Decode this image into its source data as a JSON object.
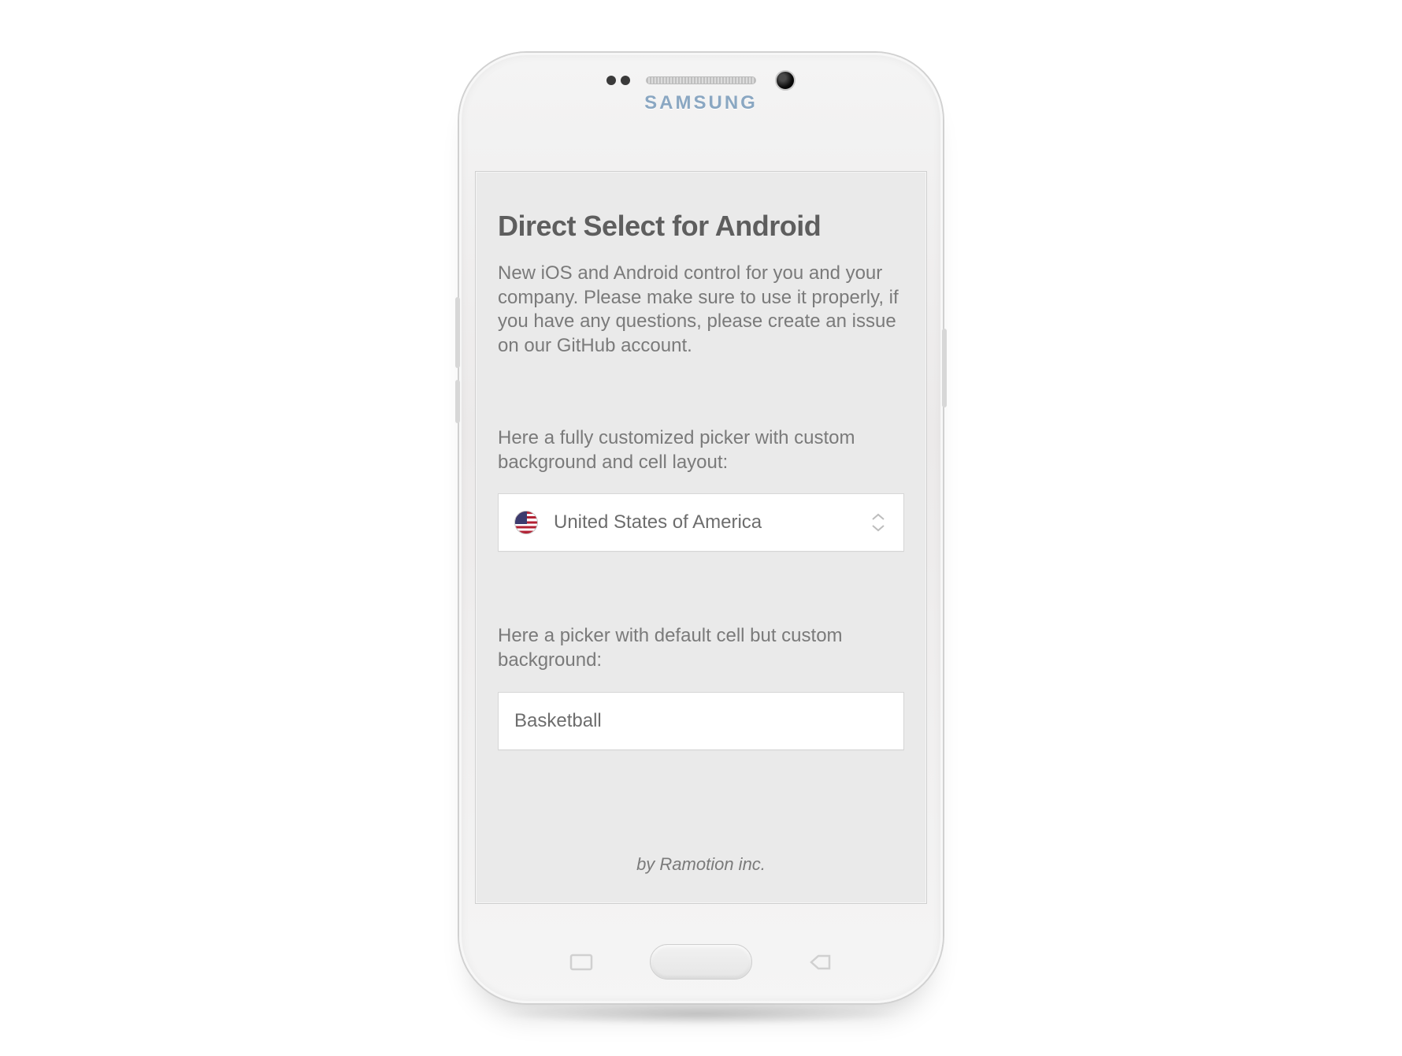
{
  "brand_text": "SAMSUNG",
  "screen": {
    "title": "Direct Select for Android",
    "intro": "New iOS and Android control for you and your company. Please make sure to use it properly, if you have any questions, please create an issue on our GitHub account.",
    "picker1": {
      "label": "Here a fully customized picker with custom background and cell layout:",
      "value": "United States of America",
      "icon": "flag-us-icon"
    },
    "picker2": {
      "label": "Here a picker with default cell but custom background:",
      "value": "Basketball"
    },
    "footer": "by Ramotion inc."
  }
}
